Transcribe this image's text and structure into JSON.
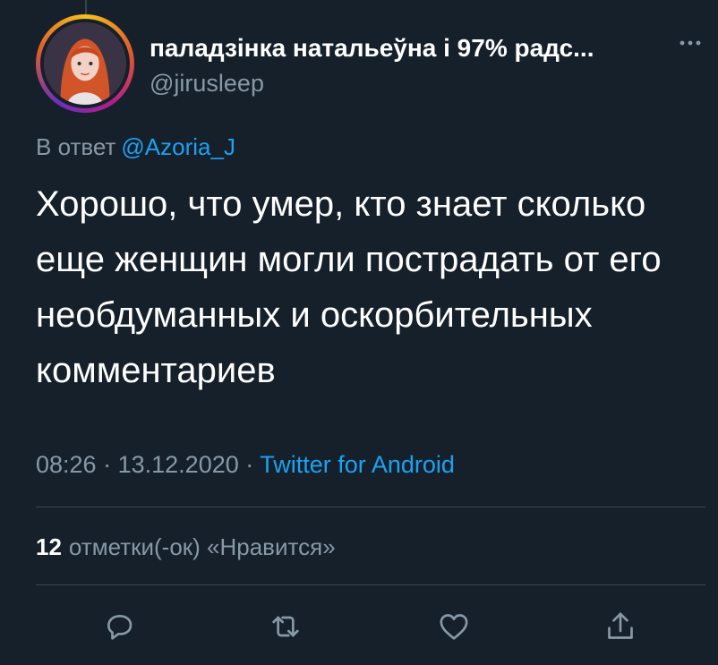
{
  "tweet": {
    "display_name": "паладзінка натальеўна і 97% радс...",
    "handle": "@jirusleep",
    "reply_prefix": "В ответ",
    "reply_mention": "@Azoria_J",
    "text": "Хорошо, что умер, кто знает сколько еще женщин могли пострадать от его необдуманных и оскорбительных комментариев",
    "time": "08:26",
    "separator": "·",
    "date": "13.12.2020",
    "source": "Twitter for Android"
  },
  "stats": {
    "likes_count": "12",
    "likes_label": "отметки(-ок) «Нравится»"
  },
  "actions": [
    "reply-icon",
    "retweet-icon",
    "like-icon",
    "share-icon"
  ],
  "colors": {
    "background": "#15202b",
    "text": "#ffffff",
    "secondary": "#8899a6",
    "accent": "#1da1f2",
    "divider": "#38444d"
  }
}
